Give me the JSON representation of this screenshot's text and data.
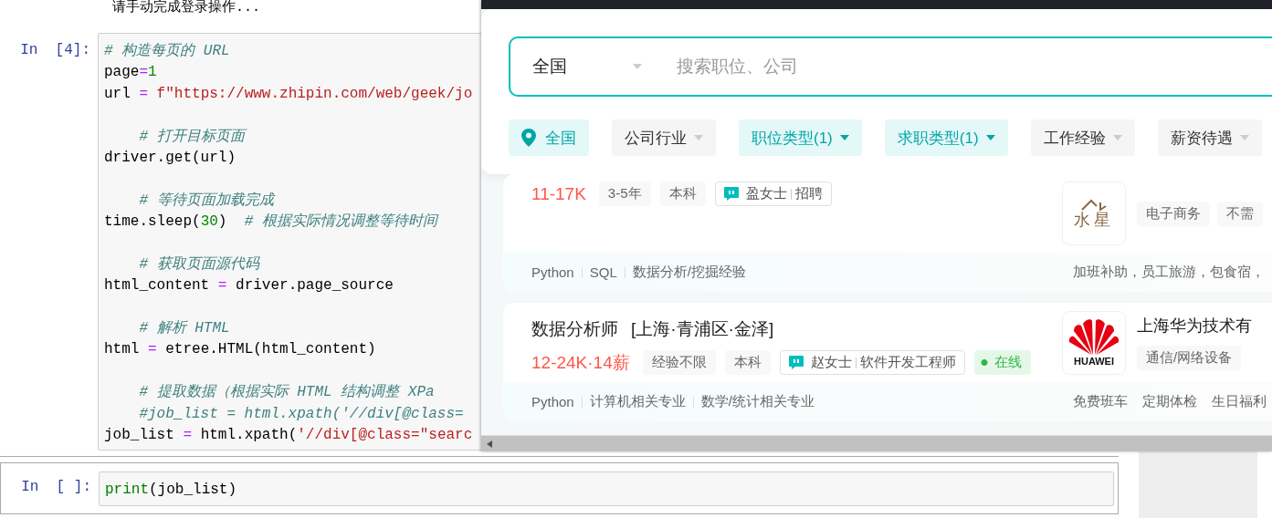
{
  "notebook": {
    "notice": "请手动完成登录操作...",
    "cells": [
      {
        "prompt": "In  [4]:",
        "lines": [
          {
            "kind": "code",
            "indent": false,
            "tokens": [
              {
                "kind": "comment",
                "text": "# 构造每页的 URL"
              }
            ]
          },
          {
            "kind": "code",
            "indent": false,
            "tokens": [
              {
                "kind": "name",
                "text": "page"
              },
              {
                "kind": "op",
                "text": "="
              },
              {
                "kind": "number",
                "text": "1"
              }
            ]
          },
          {
            "kind": "code",
            "indent": false,
            "tokens": [
              {
                "kind": "name",
                "text": "url "
              },
              {
                "kind": "op",
                "text": "="
              },
              {
                "kind": "string",
                "text": " f\"https://www.zhipin.com/web/geek/jo"
              }
            ]
          },
          {
            "kind": "blank"
          },
          {
            "kind": "code",
            "indent": true,
            "tokens": [
              {
                "kind": "comment",
                "text": "# 打开目标页面"
              }
            ]
          },
          {
            "kind": "code",
            "indent": false,
            "tokens": [
              {
                "kind": "name",
                "text": "driver.get(url)"
              }
            ]
          },
          {
            "kind": "blank"
          },
          {
            "kind": "code",
            "indent": true,
            "tokens": [
              {
                "kind": "comment",
                "text": "# 等待页面加载完成"
              }
            ]
          },
          {
            "kind": "code",
            "indent": false,
            "tokens": [
              {
                "kind": "name",
                "text": "time.sleep("
              },
              {
                "kind": "number",
                "text": "30"
              },
              {
                "kind": "name",
                "text": ")  "
              },
              {
                "kind": "comment",
                "text": "# 根据实际情况调整等待时间"
              }
            ]
          },
          {
            "kind": "blank"
          },
          {
            "kind": "code",
            "indent": true,
            "tokens": [
              {
                "kind": "comment",
                "text": "# 获取页面源代码"
              }
            ]
          },
          {
            "kind": "code",
            "indent": false,
            "tokens": [
              {
                "kind": "name",
                "text": "html_content "
              },
              {
                "kind": "op",
                "text": "="
              },
              {
                "kind": "name",
                "text": " driver.page_source"
              }
            ]
          },
          {
            "kind": "blank"
          },
          {
            "kind": "code",
            "indent": true,
            "tokens": [
              {
                "kind": "comment",
                "text": "# 解析 HTML"
              }
            ]
          },
          {
            "kind": "code",
            "indent": false,
            "tokens": [
              {
                "kind": "name",
                "text": "html "
              },
              {
                "kind": "op",
                "text": "="
              },
              {
                "kind": "name",
                "text": " etree.HTML(html_content)"
              }
            ]
          },
          {
            "kind": "blank"
          },
          {
            "kind": "code",
            "indent": true,
            "tokens": [
              {
                "kind": "comment",
                "text": "# 提取数据（根据实际 HTML 结构调整 XPa"
              }
            ]
          },
          {
            "kind": "code",
            "indent": true,
            "tokens": [
              {
                "kind": "comment",
                "text": "#job_list = html.xpath('//div[@class="
              }
            ]
          },
          {
            "kind": "code",
            "indent": false,
            "tokens": [
              {
                "kind": "name",
                "text": "job_list "
              },
              {
                "kind": "op",
                "text": "="
              },
              {
                "kind": "name",
                "text": " html.xpath("
              },
              {
                "kind": "string",
                "text": "'//div[@class=\"searc"
              }
            ]
          }
        ]
      },
      {
        "prompt": "In  [ ]:",
        "lines": [
          {
            "kind": "code",
            "indent": false,
            "tokens": [
              {
                "kind": "builtin",
                "text": "print"
              },
              {
                "kind": "name",
                "text": "(job_list)"
              }
            ]
          }
        ]
      }
    ]
  },
  "browser": {
    "search": {
      "city": "全国",
      "placeholder": "搜索职位、公司"
    },
    "filters": [
      {
        "label": "全国",
        "kind": "location",
        "selected": true
      },
      {
        "label": "公司行业",
        "kind": "dropdown",
        "selected": false
      },
      {
        "label": "职位类型(1)",
        "kind": "dropdown",
        "selected": true
      },
      {
        "label": "求职类型(1)",
        "kind": "dropdown",
        "selected": true
      },
      {
        "label": "工作经验",
        "kind": "dropdown",
        "selected": false
      },
      {
        "label": "薪资待遇",
        "kind": "dropdown",
        "selected": false
      }
    ],
    "jobs": [
      {
        "salary": "11-17K",
        "tags": [
          "3-5年",
          "本科"
        ],
        "recruiter": {
          "name": "盈女士",
          "role": "招聘"
        },
        "company": {
          "logo": {
            "kind": "monogram",
            "text": "水星"
          },
          "tags": [
            "电子商务",
            "不需"
          ]
        },
        "skills": [
          "Python",
          "SQL",
          "数据分析/挖掘经验"
        ],
        "benefits": [
          "加班补助，员工旅游，包食宿，"
        ]
      },
      {
        "title": "数据分析师",
        "location": "[上海·青浦区·金泽]",
        "salary": "12-24K·14薪",
        "tags": [
          "经验不限",
          "本科"
        ],
        "recruiter": {
          "name": "赵女士",
          "role": "软件开发工程师"
        },
        "status": "在线",
        "company": {
          "name": "上海华为技术有",
          "logo": {
            "kind": "fan",
            "text": "HUAWEI"
          },
          "tags": [
            "通信/网络设备"
          ]
        },
        "skills": [
          "Python",
          "计算机相关专业",
          "数学/统计相关专业"
        ],
        "benefits": [
          "免费班车",
          "定期体检",
          "生日福利"
        ]
      }
    ]
  }
}
